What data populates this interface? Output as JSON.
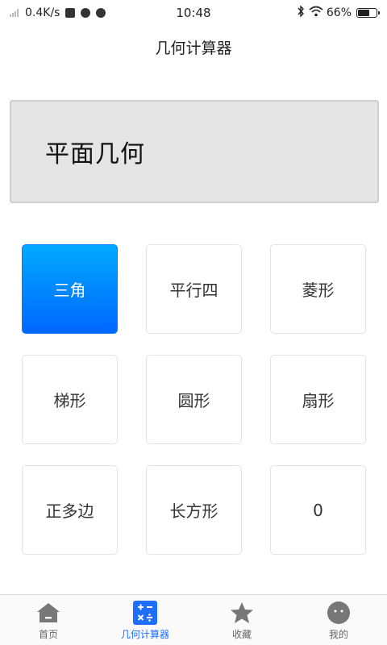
{
  "status_bar": {
    "network_speed": "0.4K/s",
    "time": "10:48",
    "battery_percent": "66%"
  },
  "header": {
    "title": "几何计算器"
  },
  "display": {
    "text": "平面几何"
  },
  "grid": {
    "items": [
      {
        "label": "三角",
        "active": true
      },
      {
        "label": "平行四",
        "active": false
      },
      {
        "label": "菱形",
        "active": false
      },
      {
        "label": "梯形",
        "active": false
      },
      {
        "label": "圆形",
        "active": false
      },
      {
        "label": "扇形",
        "active": false
      },
      {
        "label": "正多边",
        "active": false
      },
      {
        "label": "长方形",
        "active": false
      },
      {
        "label": "0",
        "active": false
      }
    ]
  },
  "bottom_nav": {
    "items": [
      {
        "label": "首页",
        "icon": "home-icon"
      },
      {
        "label": "几何计算器",
        "icon": "calculator-icon"
      },
      {
        "label": "收藏",
        "icon": "star-icon"
      },
      {
        "label": "我的",
        "icon": "profile-icon"
      }
    ],
    "active_color": "#1f6fff"
  },
  "colors": {
    "accent_top": "#00aaff",
    "accent_bottom": "#0066ff"
  }
}
